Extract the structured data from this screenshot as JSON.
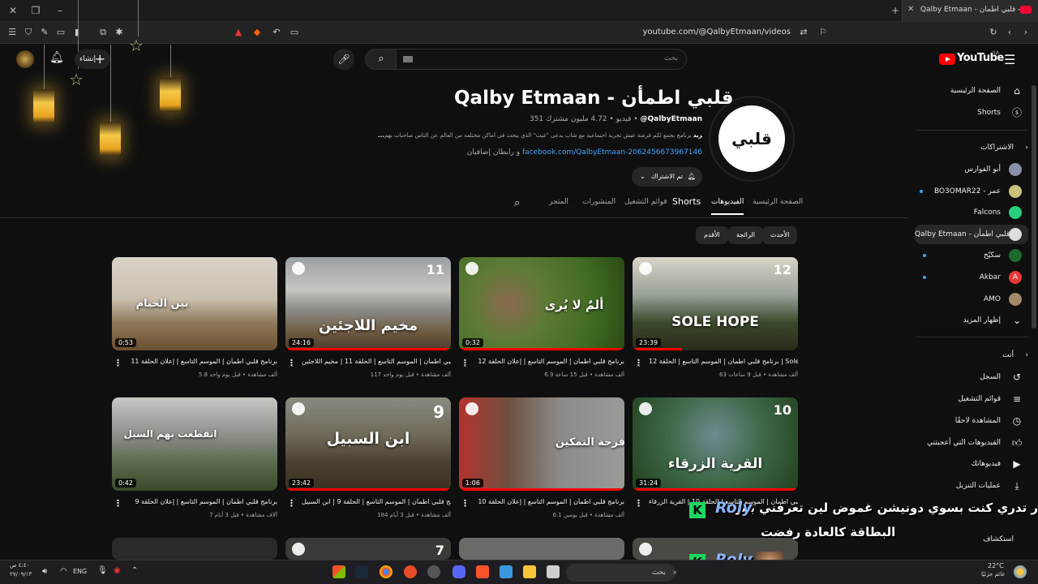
{
  "browser": {
    "tab_title": "Qalby Etmaan - قلبي اطمأن - You",
    "url": "youtube.com/@QalbyEtmaan/videos"
  },
  "header": {
    "search_placeholder": "بحث",
    "create_label": "إنشاء",
    "logo_text": "YouTube",
    "logo_region": "SA"
  },
  "sidebar": {
    "home": "الصفحة الرئيسية",
    "shorts": "Shorts",
    "subscriptions_heading": "الاشتراكات",
    "subscriptions": [
      {
        "name": "أبو الفوارس",
        "dot": false
      },
      {
        "name": "BO3OMAR22 - عمر",
        "dot": true
      },
      {
        "name": "Falcons",
        "dot": false
      },
      {
        "name": "Qalby Etmaan - قلبي اطمأن",
        "dot": false
      },
      {
        "name": "سكيّح",
        "dot": true
      },
      {
        "name": "Akbar",
        "dot": true
      },
      {
        "name": "AMO",
        "dot": false
      }
    ],
    "show_more": "إظهار المزيد",
    "you_heading": "أنت",
    "you_items": [
      "السجل",
      "قوائم التشغيل",
      "المشاهدة لاحقًا",
      "الفيديوهات التي أعجبتني",
      "فيديوهاتك",
      "عمليات التنزيل"
    ],
    "explore": "استكشاف"
  },
  "channel": {
    "title": "Qalby Etmaan - قلبي اطمأن",
    "handle": "@QalbyEtmaan",
    "subscribers": "4.72 مليون مشترك",
    "videos_count": "351 فيديو",
    "description": "برنامج يجمع لكم فرصة عيش تجربة اجتماعية مع شاب يدعى \"غيث\" الذي يبحث في أماكن مختلفة من العالم عن الناس صاحبات بهم...",
    "more": "...المزيد",
    "link": "facebook.com/QalbyEtmaan-2062456673967146",
    "link_suffix": "و رابطان إضافيان",
    "subscribed_label": "تم الاشتراك",
    "avatar_text": "قلبي اطمأن"
  },
  "tabs": [
    "الصفحة الرئيسية",
    "الفيديوهات",
    "Shorts",
    "قوائم التشغيل",
    "المنشورات",
    "المتجر"
  ],
  "chips": [
    "الأحدث",
    "الرائجة",
    "الأقدم"
  ],
  "videos": [
    {
      "title": "برنامج قلبي اطمأن | الموسم التاسع | الحلقة 12 | Sole Hope",
      "meta": "63 ألف مشاهدة • قبل 9 ساعات",
      "duration": "23:39",
      "thumb_text": "SOLE HOPE",
      "num": "12",
      "progress": 0.3
    },
    {
      "title": "برنامج قلبي اطمأن | الموسم التاسع | إعلان الحلقة 12",
      "meta": "6.9 ألف مشاهدة • قبل 15 ساعة",
      "duration": "0:32",
      "thumb_text": "ألمٌ لا يُرى",
      "num": "",
      "progress": 1
    },
    {
      "title": "برنامج قلبي اطمأن | الموسم التاسع | الحلقة 11 | مخيم اللاجئين",
      "meta": "117 ألف مشاهدة • قبل يوم واحد",
      "duration": "24:16",
      "thumb_text": "مخيم اللاجئين",
      "num": "11",
      "progress": 1
    },
    {
      "title": "برنامج قلبي اطمأن | الموسم التاسع | إعلان الحلقة 11",
      "meta": "5.8 ألف مشاهدة • قبل يوم واحد",
      "duration": "0:53",
      "thumb_text": "بين الخيام",
      "num": "",
      "progress": 0
    },
    {
      "title": "برنامج قلبي اطمأن | الموسم التاسع | الحلقة 10 | القرية الزرقاء",
      "meta": "",
      "duration": "31:24",
      "thumb_text": "القرية الزرقاء",
      "num": "10",
      "progress": 1
    },
    {
      "title": "برنامج قلبي اطمأن | الموسم التاسع | إعلان الحلقة 10",
      "meta": "6.1 ألف مشاهدة • قبل يومين",
      "duration": "1:06",
      "thumb_text": "فرحة التمكين",
      "num": "",
      "progress": 1
    },
    {
      "title": "برنامج قلبي اطمأن | الموسم التاسع | الحلقة 9 | ابن السبيل",
      "meta": "184 ألف مشاهدة • قبل 3 أيام",
      "duration": "23:42",
      "thumb_text": "ابن السبيل",
      "num": "9",
      "progress": 1
    },
    {
      "title": "برنامج قلبي اطمأن | الموسم التاسع | إعلان الحلقة 9",
      "meta": "7 آلاف مشاهدة • قبل 3 أيام",
      "duration": "0:42",
      "thumb_text": "انقطعت بهم السبل",
      "num": "",
      "progress": 0
    }
  ],
  "row3_nums": [
    "7"
  ],
  "overlay": {
    "line1": "ر تدري كنت بسوي دونيشن غموض لين تعرفني بس",
    "line2": "البطاقة كالعادة رفضت",
    "name": "Roly",
    "k": "K"
  },
  "taskbar": {
    "search": "بحث",
    "lang": "ENG",
    "time": "٤:٤٠ ص",
    "date": "٢٧/٠٩/١٣",
    "temp": "22°C",
    "weather": "غائم جزئيًا"
  },
  "colors": {
    "accent": "#ff0000",
    "link": "#3ea6ff",
    "bg": "#0f0f0f"
  }
}
